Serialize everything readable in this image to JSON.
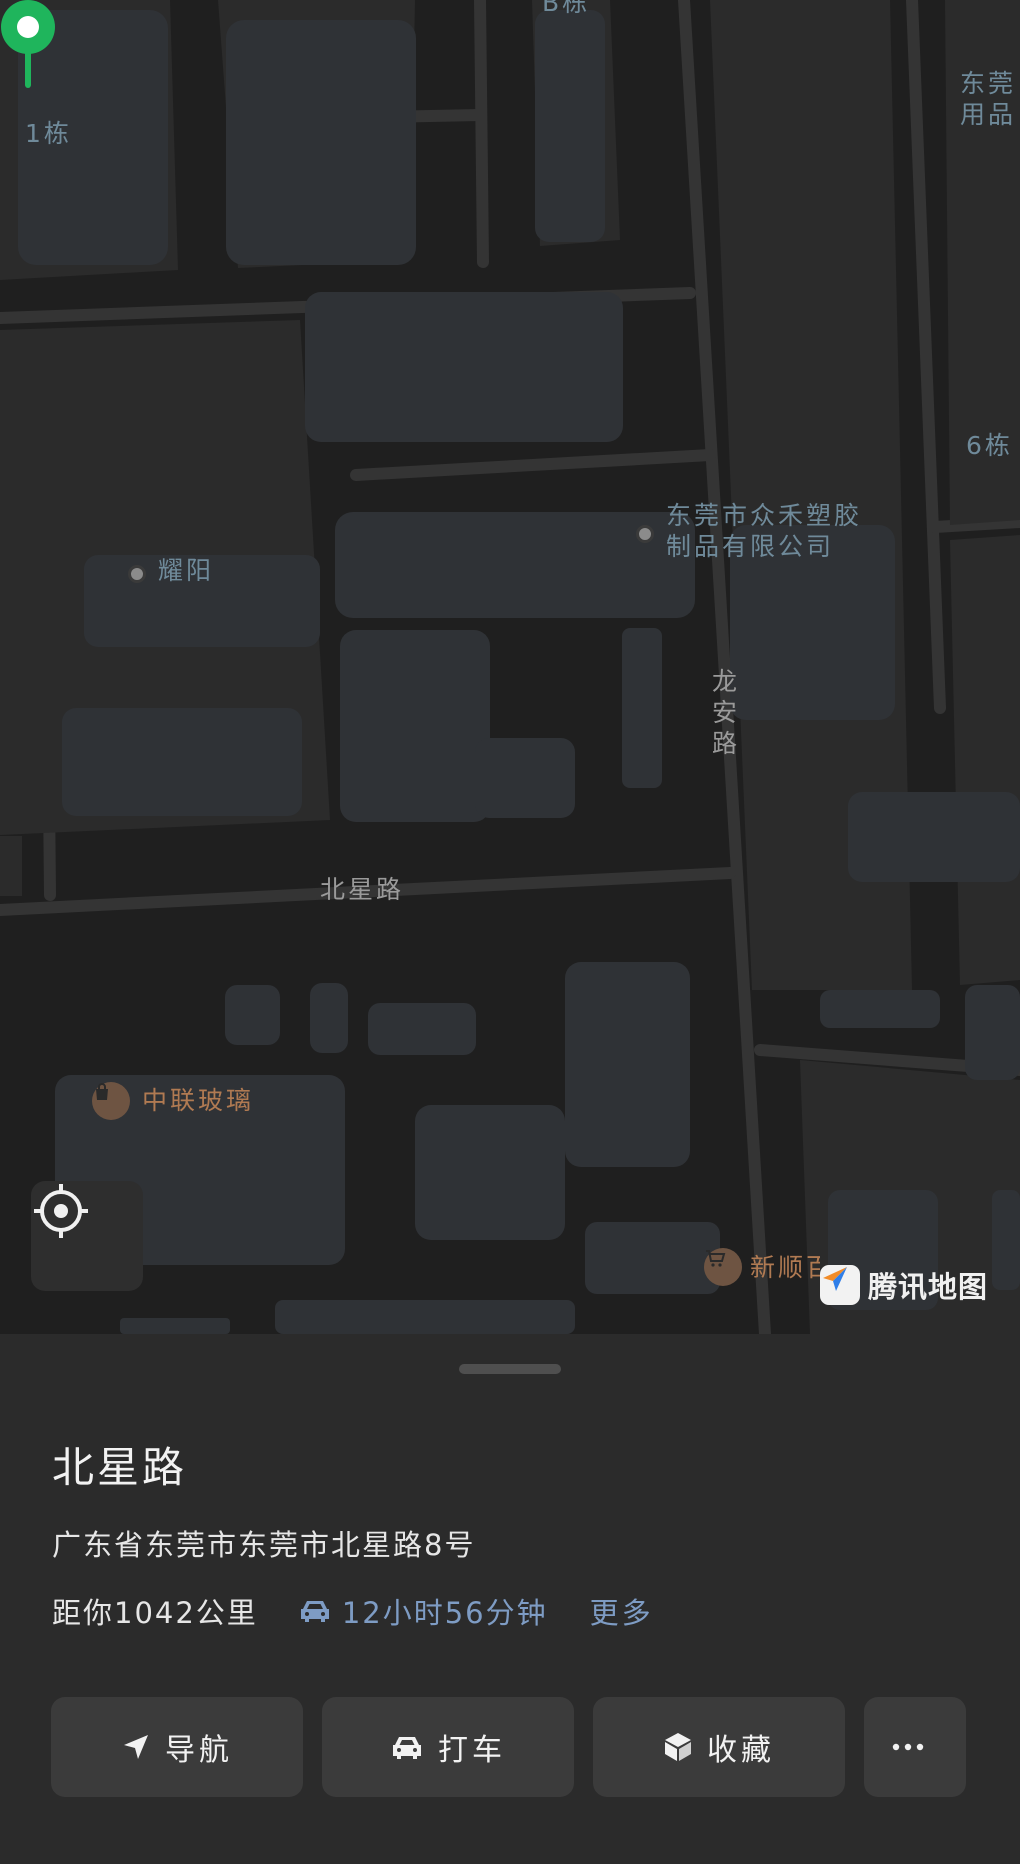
{
  "map": {
    "labels": {
      "building_b": "B栋",
      "building_1": "1栋",
      "building_6": "6栋",
      "corner_company": "东莞用品",
      "company_line1": "东莞市众禾塑胶",
      "company_line2": "制品有限公司",
      "yaoyang": "耀阳",
      "longan_road": "龙安路",
      "beixing_road": "北星路",
      "zhonglian_glass": "中联玻璃",
      "xinshun_store": "新顺百货"
    },
    "brand": "腾讯地图",
    "colors": {
      "pin": "#1fb55c",
      "poi_orange": "#b07a52",
      "label_blue": "#6f8a9a"
    }
  },
  "place": {
    "name": "北星路",
    "address": "广东省东莞市东莞市北星路8号",
    "distance": "距你1042公里",
    "drive_time": "12小时56分钟",
    "more_label": "更多"
  },
  "actions": {
    "navigate": "导航",
    "taxi": "打车",
    "favorite": "收藏",
    "more_icon": "more-dots-icon"
  }
}
